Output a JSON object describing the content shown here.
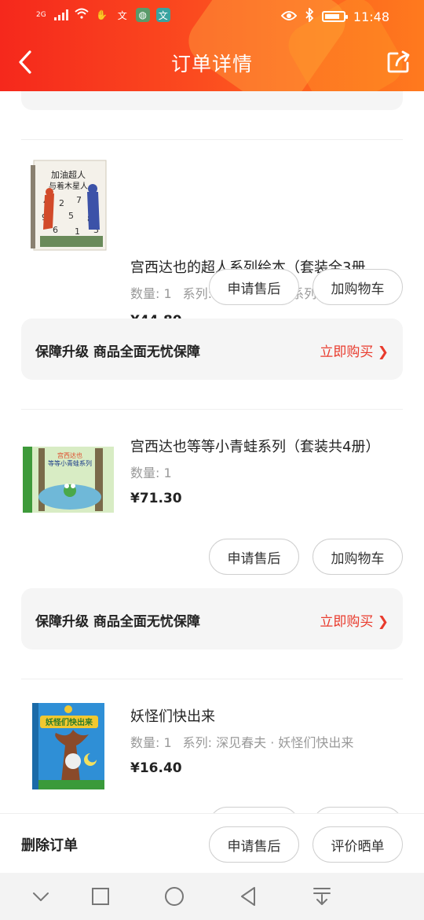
{
  "status_bar": {
    "network": "2G",
    "time": "11:48"
  },
  "header": {
    "title": "订单详情"
  },
  "items": [
    {
      "name": "宫西达也的超人系列绘本（套装全3册…",
      "qty_label": "数量: 1",
      "series_label": "系列: 宫西达也超人系列绘本",
      "price": "¥44.80",
      "btn_after_sale": "申请售后",
      "btn_add_cart": "加购物车",
      "guard_text": "保障升级  商品全面无忧保障",
      "guard_link": "立即购买 ❯",
      "cover": {
        "title_1": "加油超人",
        "title_2": "与着木星人",
        "bg": "#f4f1ea"
      }
    },
    {
      "name": "宫西达也等等小青蛙系列（套装共4册）",
      "qty_label": "数量: 1",
      "series_label": "",
      "price": "¥71.30",
      "btn_after_sale": "申请售后",
      "btn_add_cart": "加购物车",
      "guard_text": "保障升级  商品全面无忧保障",
      "guard_link": "立即购买 ❯",
      "cover": {
        "title_1": "宫西达也",
        "title_2": "等等小青蛙系列",
        "bg": "#7cc94a"
      }
    },
    {
      "name": "妖怪们快出来",
      "qty_label": "数量: 1",
      "series_label": "系列: 深见春夫 · 妖怪们快出来",
      "price": "¥16.40",
      "cover": {
        "title_1": "妖怪们快出来",
        "bg": "#2f8fd6"
      }
    }
  ],
  "bottom_bar": {
    "delete_label": "删除订单",
    "after_sale_label": "申请售后",
    "review_label": "评价晒单"
  }
}
